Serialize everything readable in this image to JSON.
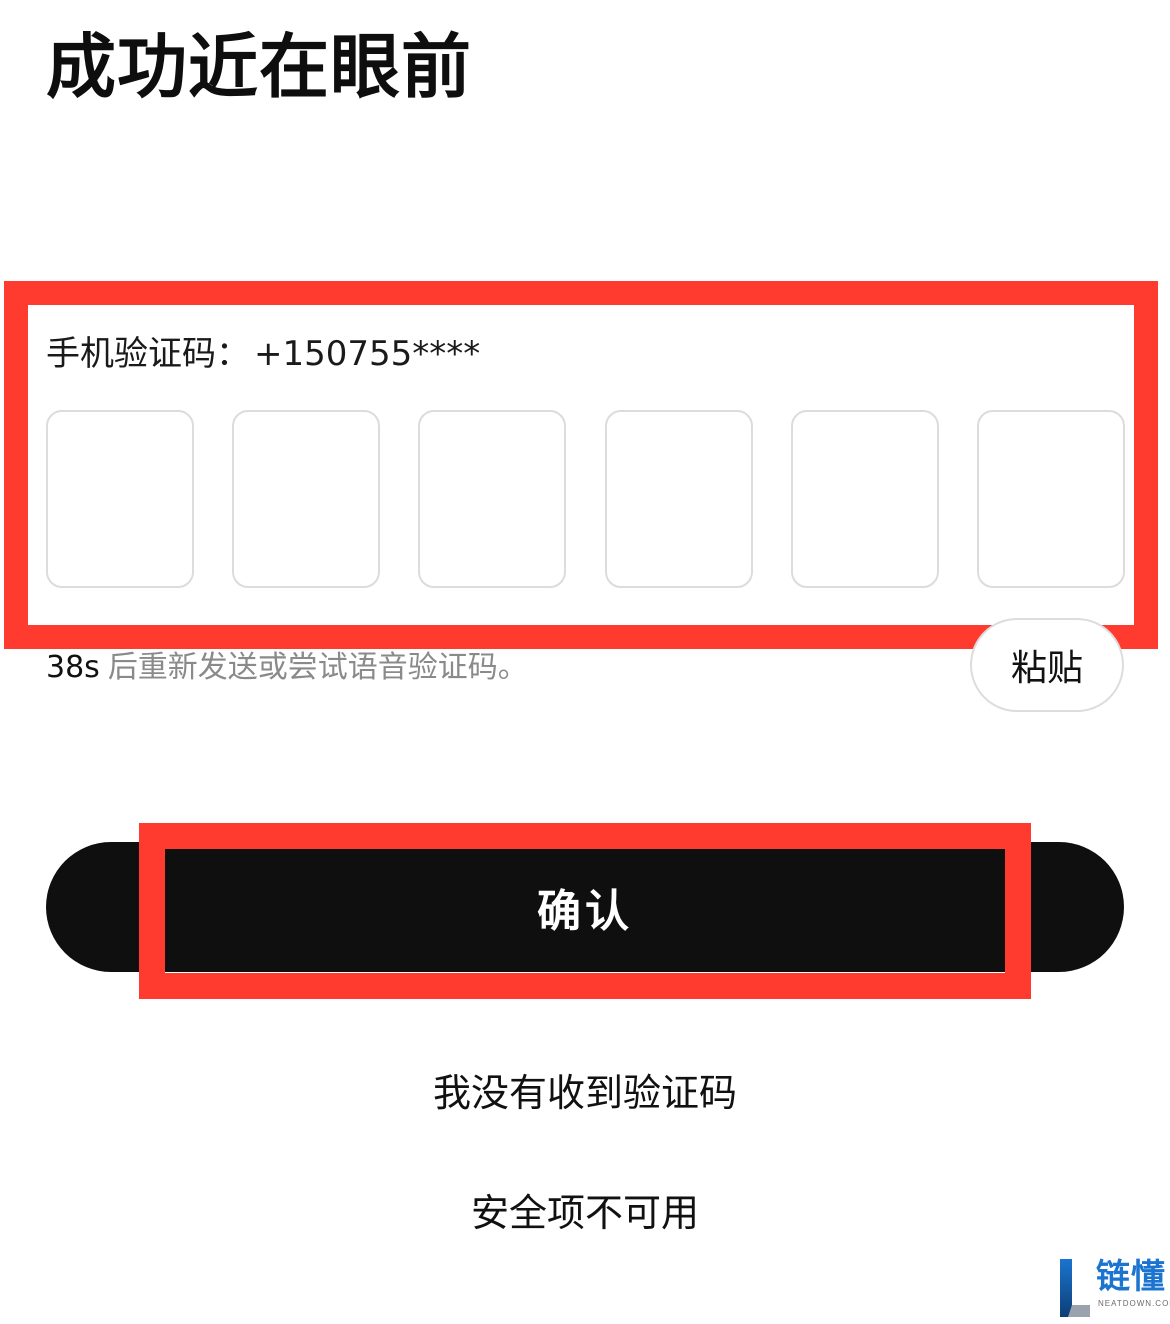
{
  "page": {
    "title": "成功近在眼前"
  },
  "verification": {
    "label": "手机验证码：",
    "phone_masked": "+150755****",
    "digits": [
      "",
      "",
      "",
      "",
      "",
      ""
    ],
    "countdown": "38s",
    "resend_text": "后重新发送或尝试语音验证码。",
    "paste_label": "粘贴"
  },
  "actions": {
    "confirm_label": "确认",
    "no_code_label": "我没有收到验证码",
    "security_unavailable_label": "安全项不可用"
  },
  "watermark": {
    "cn_text": "链懂",
    "en_text": "NEATDOWN.COM"
  },
  "colors": {
    "highlight": "#ff3b30",
    "button_bg": "#0f0f0f",
    "box_border": "#dcdcdc",
    "muted_text": "#8a8a8a",
    "watermark_blue": "#1b74d0"
  }
}
